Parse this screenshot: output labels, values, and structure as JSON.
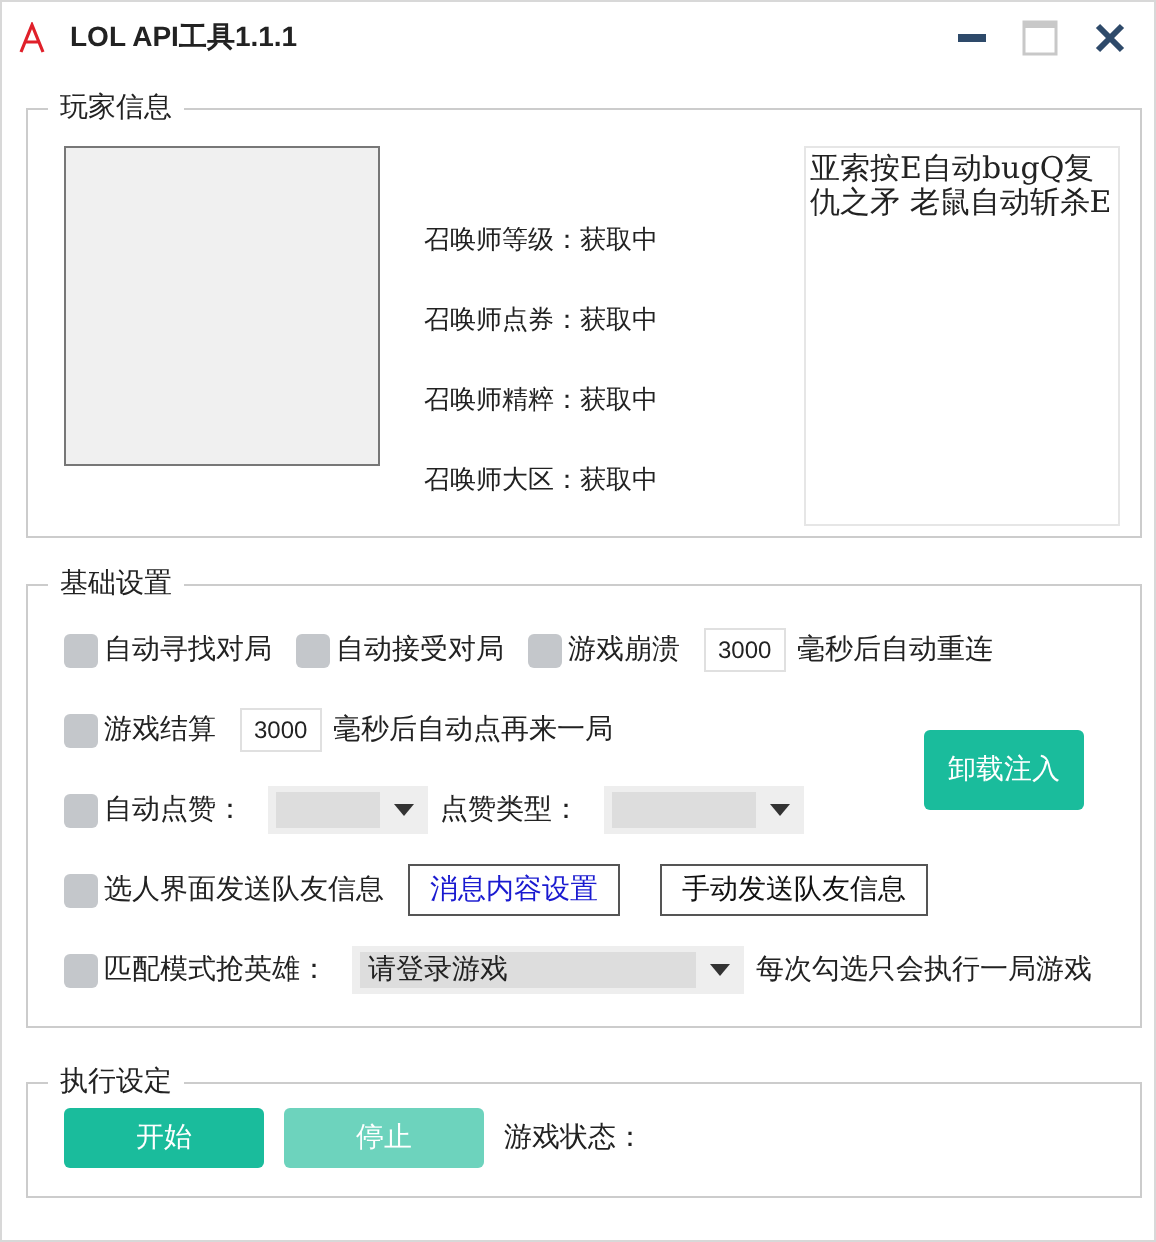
{
  "window": {
    "title": "LOL API工具1.1.1",
    "maximize_disabled": true
  },
  "player_info": {
    "title": "玩家信息",
    "fields": [
      {
        "label": "召唤师等级：",
        "value": "获取中"
      },
      {
        "label": "召唤师点券：",
        "value": "获取中"
      },
      {
        "label": "召唤师精粹：",
        "value": "获取中"
      },
      {
        "label": "召唤师大区：",
        "value": "获取中"
      }
    ],
    "notes": "亚索按E自动bugQ复仇之矛 老鼠自动斩杀E"
  },
  "basic_settings": {
    "title": "基础设置",
    "rows": [
      [
        {
          "kind": "checkbox",
          "label": "自动寻找对局",
          "checked": false
        },
        {
          "kind": "checkbox",
          "label": "自动接受对局",
          "checked": false
        },
        {
          "kind": "checkbox",
          "label": "游戏崩溃",
          "checked": false
        },
        {
          "kind": "input",
          "value": "3000"
        },
        {
          "kind": "text",
          "text": "毫秒后自动重连"
        }
      ],
      [
        {
          "kind": "checkbox",
          "label": "游戏结算",
          "checked": false
        },
        {
          "kind": "input",
          "value": "3000"
        },
        {
          "kind": "text",
          "text": "毫秒后自动点再来一局"
        }
      ],
      [
        {
          "kind": "checkbox",
          "label": "自动点赞：",
          "checked": false
        },
        {
          "kind": "select"
        },
        {
          "kind": "text",
          "text": "点赞类型："
        },
        {
          "kind": "select"
        }
      ],
      [
        {
          "kind": "checkbox",
          "label": "选人界面发送队友信息",
          "checked": false
        },
        {
          "kind": "button",
          "label": "消息内容设置"
        },
        {
          "kind": "button",
          "label": "手动发送队友信息"
        }
      ],
      [
        {
          "kind": "checkbox",
          "label": "匹配模式抢英雄：",
          "checked": false
        },
        {
          "kind": "select",
          "value": "请登录游戏"
        },
        {
          "kind": "text",
          "text": "每次勾选只会执行一局游戏"
        }
      ]
    ],
    "side_button": {
      "label": "卸载注入"
    }
  },
  "execution": {
    "title": "执行设定",
    "buttons": [
      {
        "label": "开始",
        "disabled": false
      },
      {
        "label": "停止",
        "disabled": true
      }
    ],
    "status_label": "游戏状态："
  }
}
